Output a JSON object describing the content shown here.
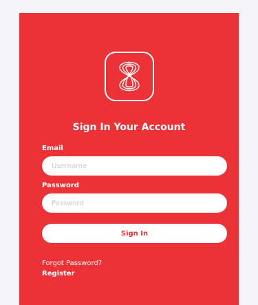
{
  "form": {
    "title": "Sign In Your Account",
    "email_label": "Email",
    "email_placeholder": "Username",
    "email_value": "",
    "password_label": "Password",
    "password_placeholder": "Password",
    "password_value": "",
    "signin_label": "Sign In",
    "forgot_label": "Forgot Password?",
    "register_label": "Register"
  },
  "logo": {
    "icon": "s-monogram-logo-icon"
  },
  "colors": {
    "card_background": "#eb3237",
    "page_background": "#f4f4f9",
    "text": "#ffffff",
    "button_background": "#ffffff",
    "button_text": "#eb3237"
  }
}
